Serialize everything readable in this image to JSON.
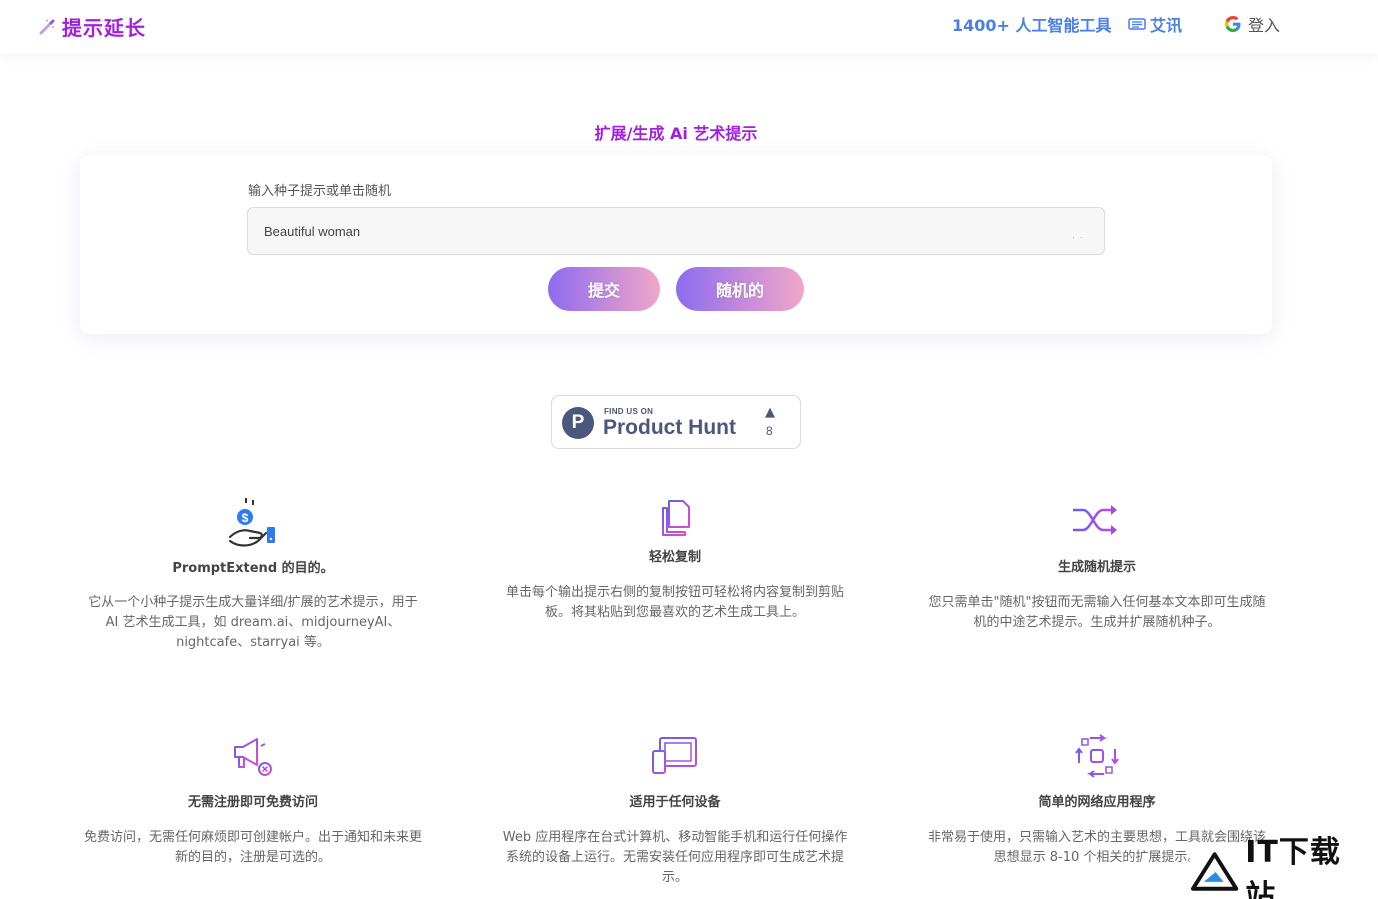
{
  "header": {
    "brand": "提示延长",
    "nav": {
      "tools": "1400+ 人工智能工具",
      "news": "艾讯",
      "login": "登入"
    }
  },
  "main": {
    "section_title": "扩展/生成 Ai 艺术提示",
    "input_label": "输入种子提示或单击随机",
    "input_value": "Beautiful woman",
    "submit_label": "提交",
    "random_label": "随机的"
  },
  "product_hunt": {
    "small_text": "FIND US ON",
    "name": "Product Hunt",
    "arrow": "▲",
    "count": "8"
  },
  "features": [
    {
      "icon": "money-hand-icon",
      "title": "PromptExtend 的目的。",
      "desc_lines": [
        "它从一个小种子提示生成大量详细/扩展的艺术提示，用于",
        "AI 艺术生成工具，如 dream.ai、midjourneyAI、",
        "nightcafe、starryai 等。"
      ]
    },
    {
      "icon": "copy-icon",
      "title": "轻松复制",
      "desc_lines": [
        "单击每个输出提示右侧的复制按钮可轻松将内容复制到剪贴",
        "板。将其粘贴到您最喜欢的艺术生成工具上。"
      ]
    },
    {
      "icon": "shuffle-icon",
      "title": "生成随机提示",
      "desc_lines": [
        "您只需单击\"随机\"按钮而无需输入任何基本文本即可生成随",
        "机的中途艺术提示。生成并扩展随机种子。"
      ]
    },
    {
      "icon": "megaphone-icon",
      "title": "无需注册即可免费访问",
      "desc_lines": [
        "免费访问，无需任何麻烦即可创建帐户。出于通知和未来更",
        "新的目的，注册是可选的。"
      ]
    },
    {
      "icon": "devices-icon",
      "title": "适用于任何设备",
      "desc_lines": [
        "Web 应用程序在台式计算机、移动智能手机和运行任何操作",
        "系统的设备上运行。无需安装任何应用程序即可生成艺术提",
        "示。"
      ]
    },
    {
      "icon": "app-cycle-icon",
      "title": "简单的网络应用程序",
      "desc_lines": [
        "非常易于使用，只需输入艺术的主要思想，工具就会围绕该",
        "思想显示 8-10 个相关的扩展提示。"
      ]
    }
  ],
  "watermark": "IT下载站",
  "colors": {
    "brand": "#a21ee0",
    "nav_link": "#4a7ee8",
    "button_gradient_start": "#8c6cf0",
    "button_gradient_end": "#f0a6c8",
    "product_hunt": "#4b587c"
  }
}
